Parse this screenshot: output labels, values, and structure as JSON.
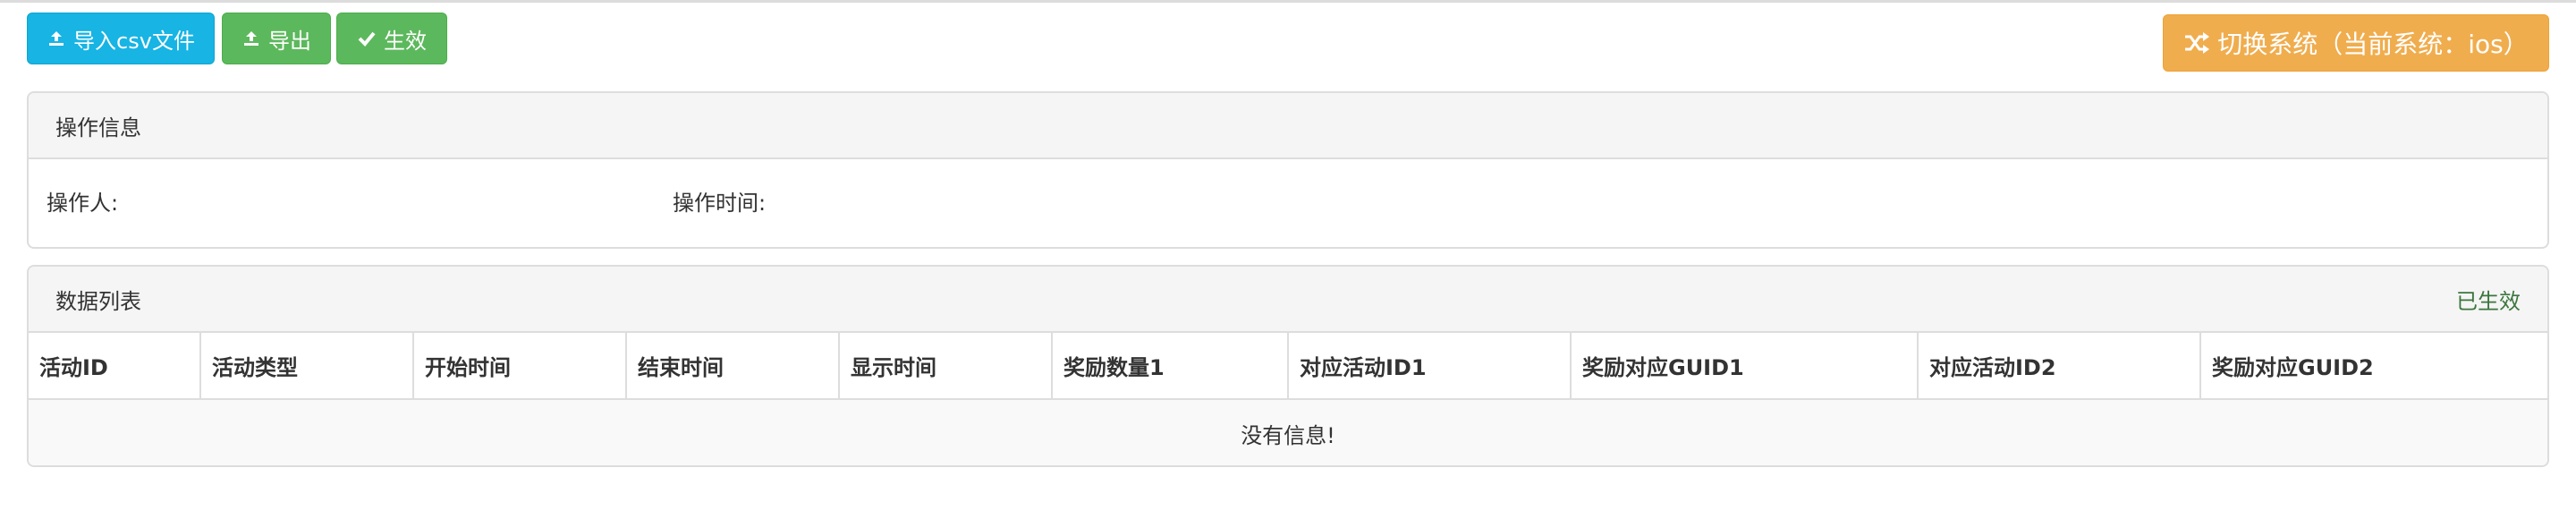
{
  "toolbar": {
    "import_label": "导入csv文件",
    "export_label": "导出",
    "apply_label": "生效",
    "switch_label": "切换系统（当前系统：ios）"
  },
  "operation_panel": {
    "title": "操作信息",
    "operator_label": "操作人:",
    "operator_value": "",
    "time_label": "操作时间:",
    "time_value": ""
  },
  "data_panel": {
    "title": "数据列表",
    "status": "已生效",
    "columns": [
      "活动ID",
      "活动类型",
      "开始时间",
      "结束时间",
      "显示时间",
      "奖励数量1",
      "对应活动ID1",
      "奖励对应GUID1",
      "对应活动ID2",
      "奖励对应GUID2"
    ],
    "empty_text": "没有信息!"
  },
  "colors": {
    "info": "#17b4e4",
    "success": "#5cb85c",
    "warning": "#f0ad4e",
    "status_text": "#3c763d"
  },
  "icons": {
    "import": "upload-icon",
    "export": "upload-icon",
    "apply": "check-icon",
    "switch": "shuffle-icon"
  }
}
